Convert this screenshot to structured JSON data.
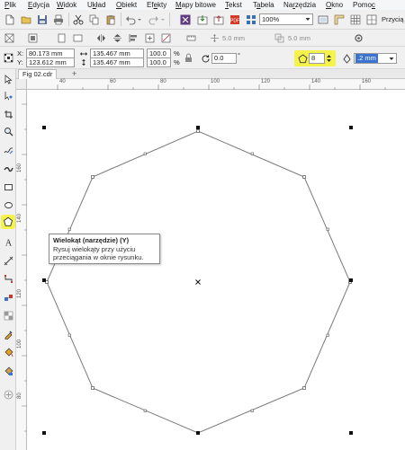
{
  "menu": [
    {
      "pre": "",
      "u": "P",
      "post": "lik"
    },
    {
      "pre": "",
      "u": "E",
      "post": "dycja"
    },
    {
      "pre": "",
      "u": "W",
      "post": "idok"
    },
    {
      "pre": "U",
      "u": "k",
      "post": "ład"
    },
    {
      "pre": "",
      "u": "O",
      "post": "biekt"
    },
    {
      "pre": "Ef",
      "u": "e",
      "post": "kty"
    },
    {
      "pre": "",
      "u": "M",
      "post": "apy bitowe"
    },
    {
      "pre": "",
      "u": "T",
      "post": "ekst"
    },
    {
      "pre": "T",
      "u": "a",
      "post": "bela"
    },
    {
      "pre": "Na",
      "u": "r",
      "post": "zędzia"
    },
    {
      "pre": "",
      "u": "O",
      "post": "kno"
    },
    {
      "pre": "Pomo",
      "u": "c",
      "post": ""
    }
  ],
  "toolbar": {
    "zoom_value": "100%",
    "snap_label": "Przycią"
  },
  "property_bar": {
    "nudge1": "5.0 mm",
    "nudge2": "5.0 mm"
  },
  "object_props": {
    "x_label": "X:",
    "x_value": "80.173 mm",
    "y_label": "Y:",
    "y_value": "123.612 mm",
    "width_value": "135.467 mm",
    "height_value": "135.467 mm",
    "scale_x": "100.0",
    "scale_y": "100.0",
    "percent": "%",
    "rotation": "0.0",
    "sides": "8",
    "outline_width": ".2 mm",
    "highlight_color": "#f5f24a"
  },
  "tabs": {
    "document": "Fig 02.cdr",
    "add": "+"
  },
  "ruler": {
    "h_labels": [
      "40",
      "60",
      "80",
      "100",
      "120",
      "140",
      "160"
    ],
    "v_labels": [
      "160",
      "140",
      "120",
      "100",
      "80"
    ]
  },
  "tooltip": {
    "title": "Wielokąt (narzędzie) (Y)",
    "body": "Rysuj wielokąty przy użyciu przeciągania w oknie rysunku."
  },
  "tools": [
    {
      "name": "pick-tool-icon"
    },
    {
      "name": "shape-tool-icon"
    },
    {
      "name": "crop-tool-icon"
    },
    {
      "name": "zoom-tool-icon"
    },
    {
      "name": "freehand-tool-icon"
    },
    {
      "name": "artistic-media-tool-icon"
    },
    {
      "name": "rectangle-tool-icon"
    },
    {
      "name": "ellipse-tool-icon"
    },
    {
      "name": "polygon-tool-icon"
    },
    {
      "name": "text-tool-icon"
    },
    {
      "name": "parallel-dimension-tool-icon"
    },
    {
      "name": "connector-tool-icon"
    },
    {
      "name": "interactive-effects-tool-icon"
    },
    {
      "name": "transparency-tool-icon"
    },
    {
      "name": "eyedropper-tool-icon"
    },
    {
      "name": "fill-tool-icon"
    },
    {
      "name": "smart-fill-tool-icon"
    },
    {
      "name": "add-tool-icon"
    }
  ]
}
